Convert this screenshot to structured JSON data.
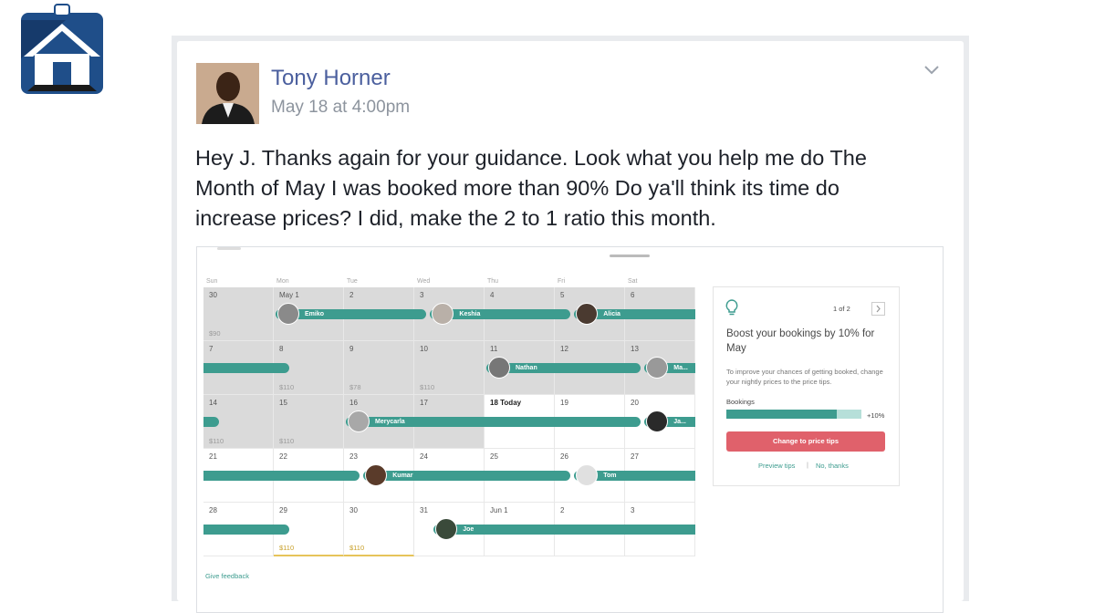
{
  "post": {
    "author": "Tony Horner",
    "timestamp": "May 18 at 4:00pm",
    "text": "Hey J. Thanks again for your guidance. Look what you help me do The Month of May I was booked more than 90% Do ya'll think its time do increase prices? I did, make the 2 to 1 ratio this month."
  },
  "calendar": {
    "weekdays": [
      "Sun",
      "Mon",
      "Tue",
      "Wed",
      "Thu",
      "Fri",
      "Sat"
    ],
    "weeks": [
      {
        "days": [
          "30",
          "May 1",
          "2",
          "3",
          "4",
          "5",
          "6"
        ],
        "prices": [
          "$90",
          "",
          "",
          "",
          "",
          "",
          ""
        ]
      },
      {
        "days": [
          "7",
          "8",
          "9",
          "10",
          "11",
          "12",
          "13"
        ],
        "prices": [
          "",
          "$110",
          "$78",
          "$110",
          "",
          "",
          ""
        ]
      },
      {
        "days": [
          "14",
          "15",
          "16",
          "17",
          "18 Today",
          "19",
          "20"
        ],
        "prices": [
          "$110",
          "$110",
          "",
          "",
          "",
          "",
          ""
        ]
      },
      {
        "days": [
          "21",
          "22",
          "23",
          "24",
          "25",
          "26",
          "27"
        ],
        "prices": [
          "",
          "",
          "",
          "",
          "",
          "",
          ""
        ]
      },
      {
        "days": [
          "28",
          "29",
          "30",
          "31",
          "Jun 1",
          "2",
          "3"
        ],
        "prices": [
          "",
          "$110",
          "$110",
          "",
          "",
          "",
          ""
        ]
      }
    ],
    "guests": [
      "Emiko",
      "Keshia",
      "Alicia",
      "Nathan",
      "Ma...",
      "Merycarla",
      "Ja...",
      "Kumar",
      "Tom",
      "Joe"
    ],
    "feedback_link": "Give feedback"
  },
  "tips": {
    "pager": "1 of 2",
    "title": "Boost your bookings by 10% for May",
    "description": "To improve your chances of getting booked, change your nightly prices to the price tips.",
    "bookings_label": "Bookings",
    "bookings_delta": "+10%",
    "bookings_fill": 0.82,
    "cta": "Change to price tips",
    "preview": "Preview tips",
    "separator": "|",
    "dismiss": "No, thanks"
  },
  "colors": {
    "brand_blue": "#4b5f9e",
    "booking_green": "#3d9c8f",
    "cta_red": "#e0616b"
  },
  "icons": [
    "home-logo-icon",
    "chevron-down-icon",
    "lightbulb-icon",
    "chevron-right-icon"
  ]
}
